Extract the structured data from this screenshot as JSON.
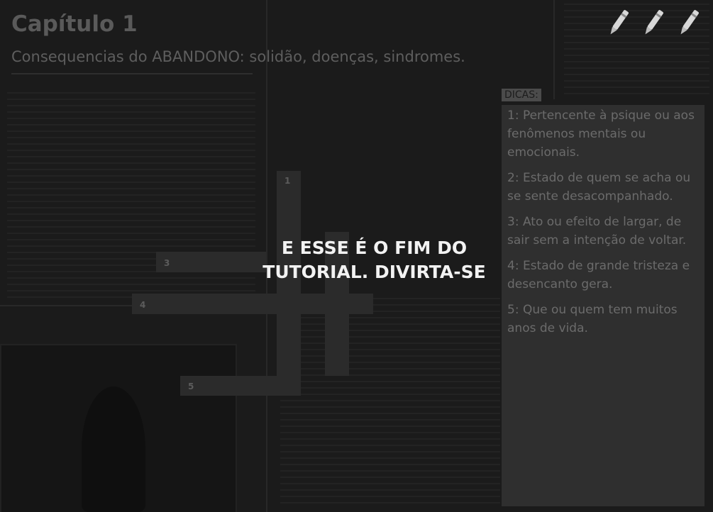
{
  "header": {
    "title": "Capítulo 1",
    "subtitle": "Consequencias do ABANDONO: solidão, doenças, sindromes."
  },
  "toolbar": {
    "pens": [
      {
        "icon": "pen-icon"
      },
      {
        "icon": "pen-icon"
      },
      {
        "icon": "pen-icon"
      }
    ]
  },
  "hints": {
    "label": "DICAS:",
    "items": [
      "1: Pertencente à psique ou aos fenômenos mentais ou emocionais.",
      "2: Estado de quem se acha ou se sente desacompanhado.",
      "3: Ato ou efeito de largar, de sair sem a intenção de voltar.",
      "4: Estado de grande tristeza e desencanto gera.",
      "5: Que ou quem tem muitos anos de vida."
    ]
  },
  "crossword": {
    "numbers": [
      "1",
      "3",
      "4",
      "5"
    ]
  },
  "overlay": {
    "line1": "E ESSE É O FIM DO",
    "line2": "TUTORIAL. DIVIRTA-SE"
  },
  "colors": {
    "background": "#1b1b1b",
    "cell": "#2b2b2b",
    "panel": "#2f2f2f",
    "overlay_text": "#f2f2f2"
  }
}
